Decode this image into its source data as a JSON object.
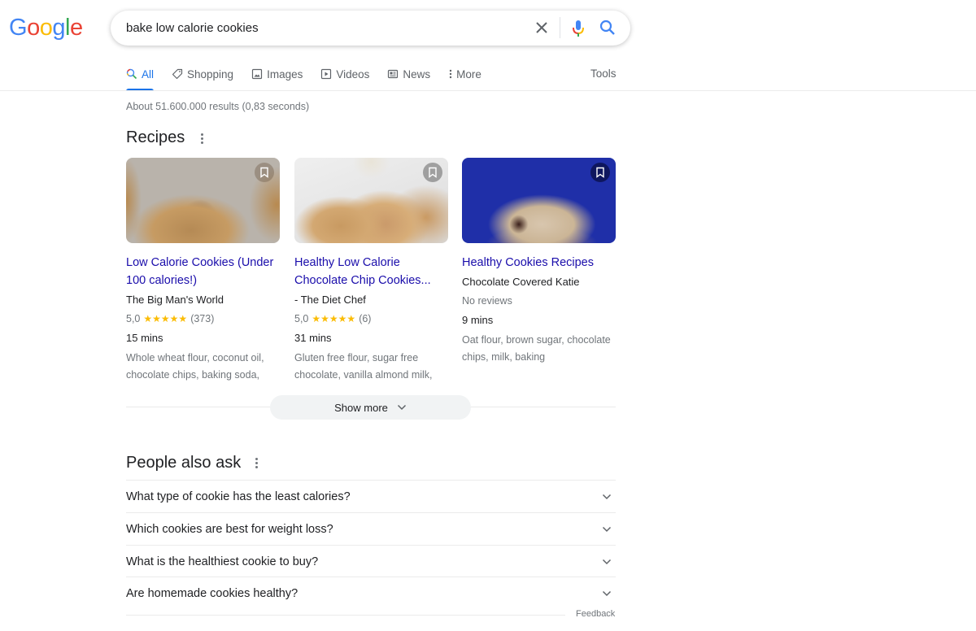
{
  "logo": {
    "letters": [
      "G",
      "o",
      "o",
      "g",
      "l",
      "e"
    ],
    "colors": [
      "#4285f4",
      "#ea4335",
      "#fbbc05",
      "#4285f4",
      "#34a853",
      "#ea4335"
    ]
  },
  "search": {
    "query": "bake low calorie cookies",
    "clear_icon": "close-icon",
    "voice_icon": "mic-icon",
    "search_icon": "search-icon"
  },
  "tabs": [
    {
      "label": "All",
      "icon": "search-icon",
      "active": true
    },
    {
      "label": "Shopping",
      "icon": "tag-icon"
    },
    {
      "label": "Images",
      "icon": "image-icon"
    },
    {
      "label": "Videos",
      "icon": "play-icon"
    },
    {
      "label": "News",
      "icon": "newspaper-icon"
    },
    {
      "label": "More",
      "icon": "kebab-icon"
    }
  ],
  "tools_label": "Tools",
  "result_stats": "About 51.600.000 results (0,83 seconds)",
  "recipes": {
    "title": "Recipes",
    "cards": [
      {
        "title": "Low Calorie Cookies (Under 100 calories!)",
        "source": "The Big Man's World",
        "rating": "5,0",
        "stars": "★★★★★",
        "reviews": "(373)",
        "time": "15 mins",
        "ingredients": "Whole wheat flour, coconut oil, chocolate chips, baking soda,"
      },
      {
        "title": "Healthy Low Calorie Chocolate Chip Cookies...",
        "source": "- The Diet Chef",
        "rating": "5,0",
        "stars": "★★★★★",
        "reviews": "(6)",
        "time": "31 mins",
        "ingredients": "Gluten free flour, sugar free chocolate, vanilla almond milk,"
      },
      {
        "title": "Healthy Cookies Recipes",
        "source": "Chocolate Covered Katie",
        "no_reviews": "No reviews",
        "time": "9 mins",
        "ingredients": "Oat flour, brown sugar, chocolate chips, milk, baking"
      }
    ],
    "show_more": "Show more"
  },
  "people_also_ask": {
    "title": "People also ask",
    "questions": [
      "What type of cookie has the least calories?",
      "Which cookies are best for weight loss?",
      "What is the healthiest cookie to buy?",
      "Are homemade cookies healthy?"
    ],
    "feedback": "Feedback"
  },
  "colors": {
    "link": "#1a0dab",
    "accent": "#1a73e8",
    "star": "#fbbc04",
    "muted": "#70757a"
  }
}
